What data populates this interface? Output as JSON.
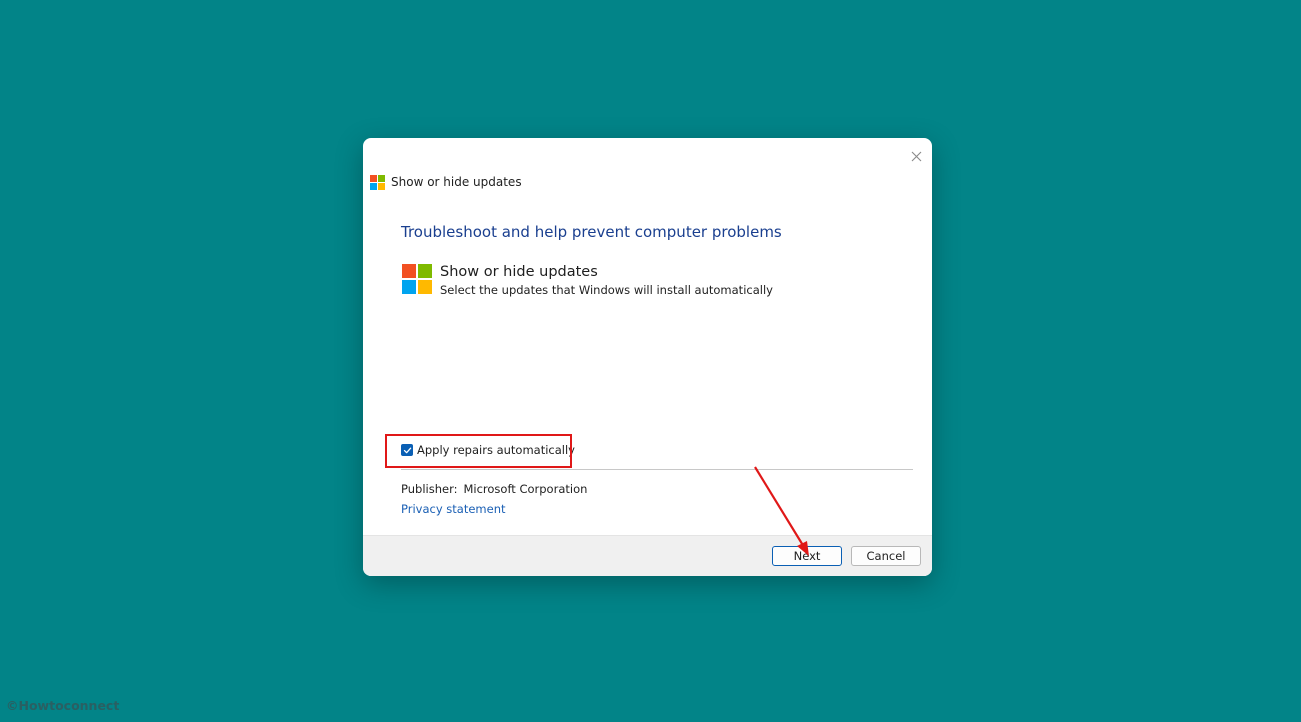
{
  "dialog": {
    "title": "Show or hide updates",
    "heading": "Troubleshoot and help prevent computer problems",
    "app_name": "Show or hide updates",
    "app_description": "Select the updates that Windows will install automatically",
    "checkbox_label": "Apply repairs automatically",
    "checkbox_checked": true,
    "publisher_label": "Publisher:",
    "publisher_value": "Microsoft Corporation",
    "privacy_link": "Privacy statement",
    "next_label": "Next",
    "cancel_label": "Cancel",
    "close_icon": "close-icon"
  },
  "logo_colors": [
    "#f25022",
    "#7fba00",
    "#00a4ef",
    "#ffb900"
  ],
  "colors": {
    "desktop": "#028488",
    "heading": "#1a3f8f",
    "accent": "#0a5fb4",
    "annotation": "#e01818"
  },
  "watermark": "©Howtoconnect"
}
